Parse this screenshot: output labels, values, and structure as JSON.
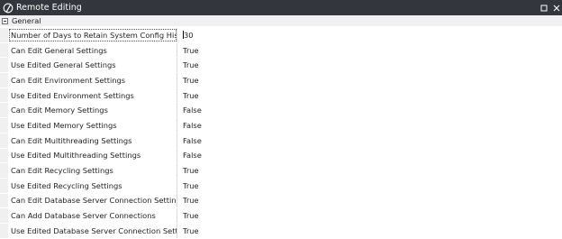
{
  "window": {
    "title": "Remote Editing",
    "app_icon": "power-slash-icon",
    "controls": [
      "restore-icon",
      "close-icon"
    ]
  },
  "category": {
    "label": "General",
    "expanded": true
  },
  "properties": [
    {
      "name": "Number of Days to Retain System Config History",
      "value": "30",
      "editing": true
    },
    {
      "name": "Can Edit General Settings",
      "value": "True"
    },
    {
      "name": "Use Edited General Settings",
      "value": "True"
    },
    {
      "name": "Can Edit Environment Settings",
      "value": "True"
    },
    {
      "name": "Use Edited Environment Settings",
      "value": "True"
    },
    {
      "name": "Can Edit Memory Settings",
      "value": "False"
    },
    {
      "name": "Use Edited Memory Settings",
      "value": "False"
    },
    {
      "name": "Can Edit Multithreading Settings",
      "value": "False"
    },
    {
      "name": "Use Edited Multithreading Settings",
      "value": "False"
    },
    {
      "name": "Can Edit Recycling Settings",
      "value": "True"
    },
    {
      "name": "Use Edited Recycling Settings",
      "value": "True"
    },
    {
      "name": "Can Edit Database Server Connection Settings",
      "value": "True"
    },
    {
      "name": "Can Add Database Server Connections",
      "value": "True"
    },
    {
      "name": "Use Edited Database Server Connection Settings",
      "value": "True"
    }
  ],
  "colors": {
    "titlebar": "#33363c",
    "gutter": "#f0f0f0",
    "divider": "#d9d9d9"
  }
}
